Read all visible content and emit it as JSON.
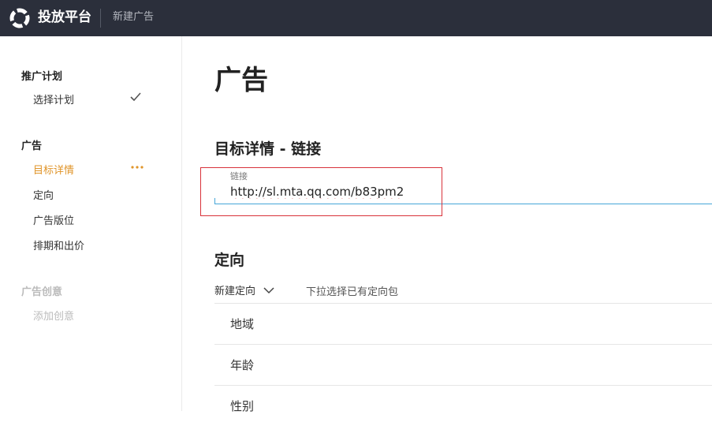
{
  "header": {
    "brand": "投放平台",
    "breadcrumb": "新建广告"
  },
  "sidebar": {
    "groups": [
      {
        "title": "推广计划",
        "items": [
          {
            "label": "选择计划",
            "status": "check-icon"
          }
        ]
      },
      {
        "title": "广告",
        "items": [
          {
            "label": "目标详情",
            "status": "more-dots-icon",
            "active": true
          },
          {
            "label": "定向"
          },
          {
            "label": "广告版位"
          },
          {
            "label": "排期和出价"
          }
        ]
      },
      {
        "title": "广告创意",
        "disabled": true,
        "items": [
          {
            "label": "添加创意",
            "disabled": true
          }
        ]
      }
    ]
  },
  "main": {
    "page_title": "广告",
    "target_section": {
      "title": "目标详情 - 链接",
      "link_label": "链接",
      "link_value": "http://sl.mta.qq.com/b83pm2"
    },
    "targeting_section": {
      "title": "定向",
      "dropdown_label": "新建定向",
      "dropdown_hint": "下拉选择已有定向包",
      "rows": [
        "地域",
        "年龄",
        "性别"
      ]
    }
  },
  "colors": {
    "topbar_bg": "#2b2f3b",
    "active_item": "#e0952a",
    "input_focus_line": "#46a6d8",
    "highlight_border": "#d8323a"
  }
}
